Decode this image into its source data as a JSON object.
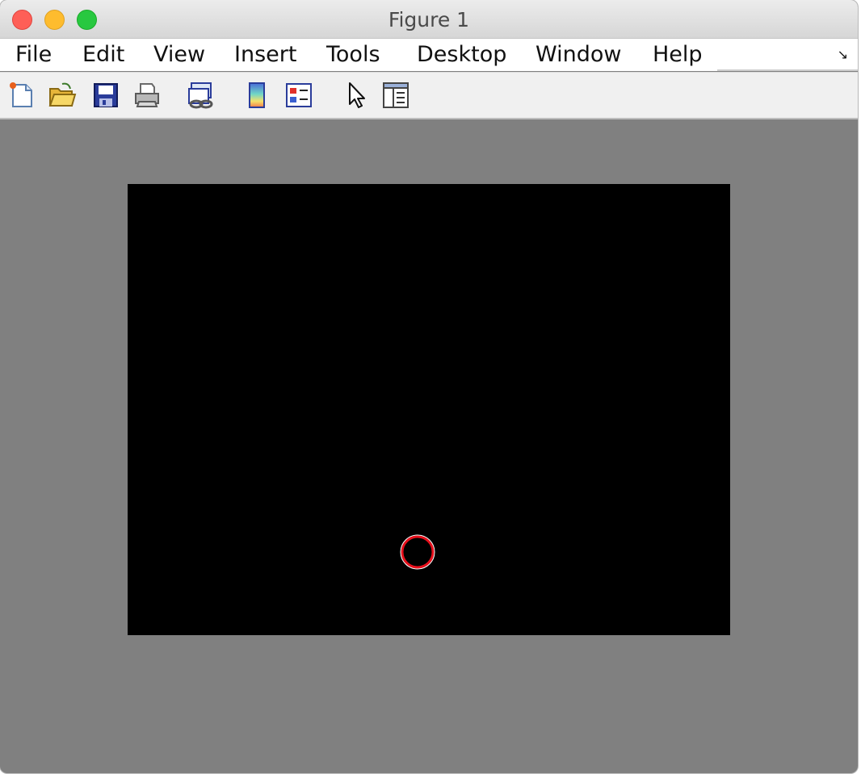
{
  "window": {
    "title": "Figure 1"
  },
  "menu": {
    "items": [
      "File",
      "Edit",
      "View",
      "Insert",
      "Tools",
      "Desktop",
      "Window",
      "Help"
    ]
  },
  "toolbar": {
    "buttons": [
      {
        "icon": "new-figure-icon"
      },
      {
        "icon": "open-file-icon"
      },
      {
        "icon": "save-icon"
      },
      {
        "icon": "print-icon"
      },
      {
        "icon": "link-plot-icon"
      },
      {
        "icon": "colorbar-icon"
      },
      {
        "icon": "legend-icon"
      },
      {
        "icon": "pointer-icon"
      },
      {
        "icon": "property-inspector-icon"
      }
    ]
  },
  "plot": {
    "background": "#000000",
    "marker_color": "#e8101c",
    "marker_shape": "circle"
  },
  "colors": {
    "figure_background": "#808080",
    "close": "#fe5f57",
    "minimize": "#febc2e",
    "maximize": "#28c840"
  }
}
